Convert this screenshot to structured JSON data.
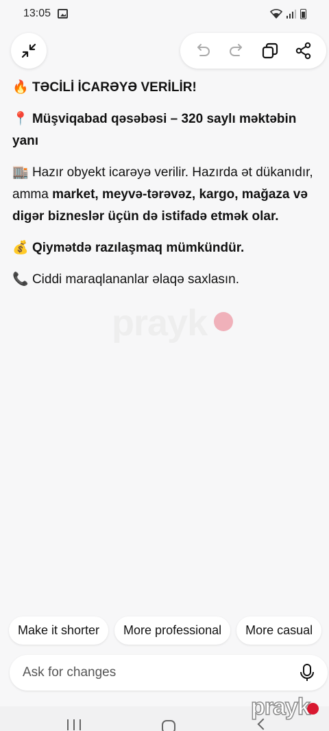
{
  "status_bar": {
    "time": "13:05",
    "icons": [
      "image-icon",
      "wifi-icon",
      "signal-icon",
      "battery-icon"
    ]
  },
  "toolbar": {
    "collapse_icon": "collapse-icon",
    "actions": [
      "undo-icon",
      "redo-icon",
      "copy-icon",
      "share-icon"
    ]
  },
  "content": {
    "p1_emoji": "🔥",
    "p1_text": "TƏCİLİ İCARƏYƏ VERİLİR!",
    "p2_emoji": "📍",
    "p2_text": "Müşviqabad qəsəbəsi – 320 saylı məktəbin yanı",
    "p3_emoji": "🏬",
    "p3_text_regular": "Hazır obyekt icarəyə verilir. Hazırda ət dükanıdır, amma ",
    "p3_text_bold": "market, meyvə-tərəvəz, kargo, mağaza və digər bizneslər üçün də istifadə etmək olar.",
    "p4_emoji": "💰",
    "p4_text": "Qiymətdə razılaşmaq mümkündür.",
    "p5_emoji": "📞",
    "p5_text": "Ciddi maraqlananlar əlaqə saxlasın."
  },
  "suggestions": [
    {
      "label": "Make it shorter"
    },
    {
      "label": "More professional"
    },
    {
      "label": "More casual"
    }
  ],
  "ask": {
    "placeholder": "Ask for changes",
    "mic_icon": "mic-icon"
  },
  "watermark": {
    "text": "prayk"
  },
  "colors": {
    "background": "#f7f7f8",
    "chip": "#ffffff",
    "watermark_dot": "#d81830"
  }
}
